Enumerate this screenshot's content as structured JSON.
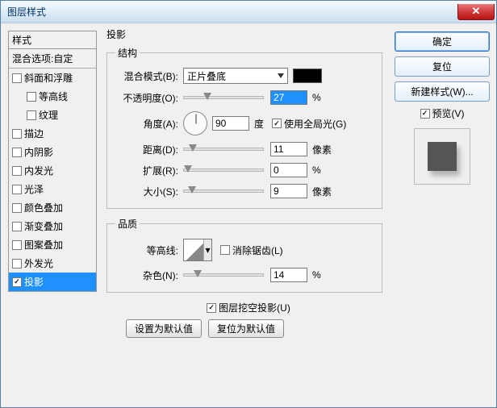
{
  "window": {
    "title": "图层样式"
  },
  "buttons": {
    "ok": "确定",
    "cancel": "复位",
    "newstyle": "新建样式(W)...",
    "preview": "预览(V)",
    "setdefault": "设置为默认值",
    "resetdefault": "复位为默认值"
  },
  "styles": {
    "header": "样式",
    "blending": "混合选项:自定",
    "items": [
      {
        "label": "斜面和浮雕",
        "checked": false,
        "indent": false
      },
      {
        "label": "等高线",
        "checked": false,
        "indent": true
      },
      {
        "label": "纹理",
        "checked": false,
        "indent": true
      },
      {
        "label": "描边",
        "checked": false,
        "indent": false
      },
      {
        "label": "内阴影",
        "checked": false,
        "indent": false
      },
      {
        "label": "内发光",
        "checked": false,
        "indent": false
      },
      {
        "label": "光泽",
        "checked": false,
        "indent": false
      },
      {
        "label": "颜色叠加",
        "checked": false,
        "indent": false
      },
      {
        "label": "渐变叠加",
        "checked": false,
        "indent": false
      },
      {
        "label": "图案叠加",
        "checked": false,
        "indent": false
      },
      {
        "label": "外发光",
        "checked": false,
        "indent": false
      },
      {
        "label": "投影",
        "checked": true,
        "indent": false,
        "selected": true
      }
    ]
  },
  "main": {
    "title": "投影",
    "structure": {
      "legend": "结构",
      "blendmode_label": "混合模式(B):",
      "blendmode_value": "正片叠底",
      "opacity_label": "不透明度(O):",
      "opacity_value": "27",
      "opacity_unit": "%",
      "angle_label": "角度(A):",
      "angle_value": "90",
      "angle_unit": "度",
      "global_label": "使用全局光(G)",
      "distance_label": "距离(D):",
      "distance_value": "11",
      "distance_unit": "像素",
      "spread_label": "扩展(R):",
      "spread_value": "0",
      "spread_unit": "%",
      "size_label": "大小(S):",
      "size_value": "9",
      "size_unit": "像素"
    },
    "quality": {
      "legend": "品质",
      "contour_label": "等高线:",
      "antialias_label": "消除锯齿(L)",
      "noise_label": "杂色(N):",
      "noise_value": "14",
      "noise_unit": "%"
    },
    "knockout_label": "图层挖空投影(U)"
  },
  "chart_data": {
    "type": "table",
    "title": "投影 参数",
    "rows": [
      {
        "name": "不透明度",
        "value": 27,
        "unit": "%"
      },
      {
        "name": "角度",
        "value": 90,
        "unit": "度"
      },
      {
        "name": "距离",
        "value": 11,
        "unit": "像素"
      },
      {
        "name": "扩展",
        "value": 0,
        "unit": "%"
      },
      {
        "name": "大小",
        "value": 9,
        "unit": "像素"
      },
      {
        "name": "杂色",
        "value": 14,
        "unit": "%"
      }
    ]
  }
}
